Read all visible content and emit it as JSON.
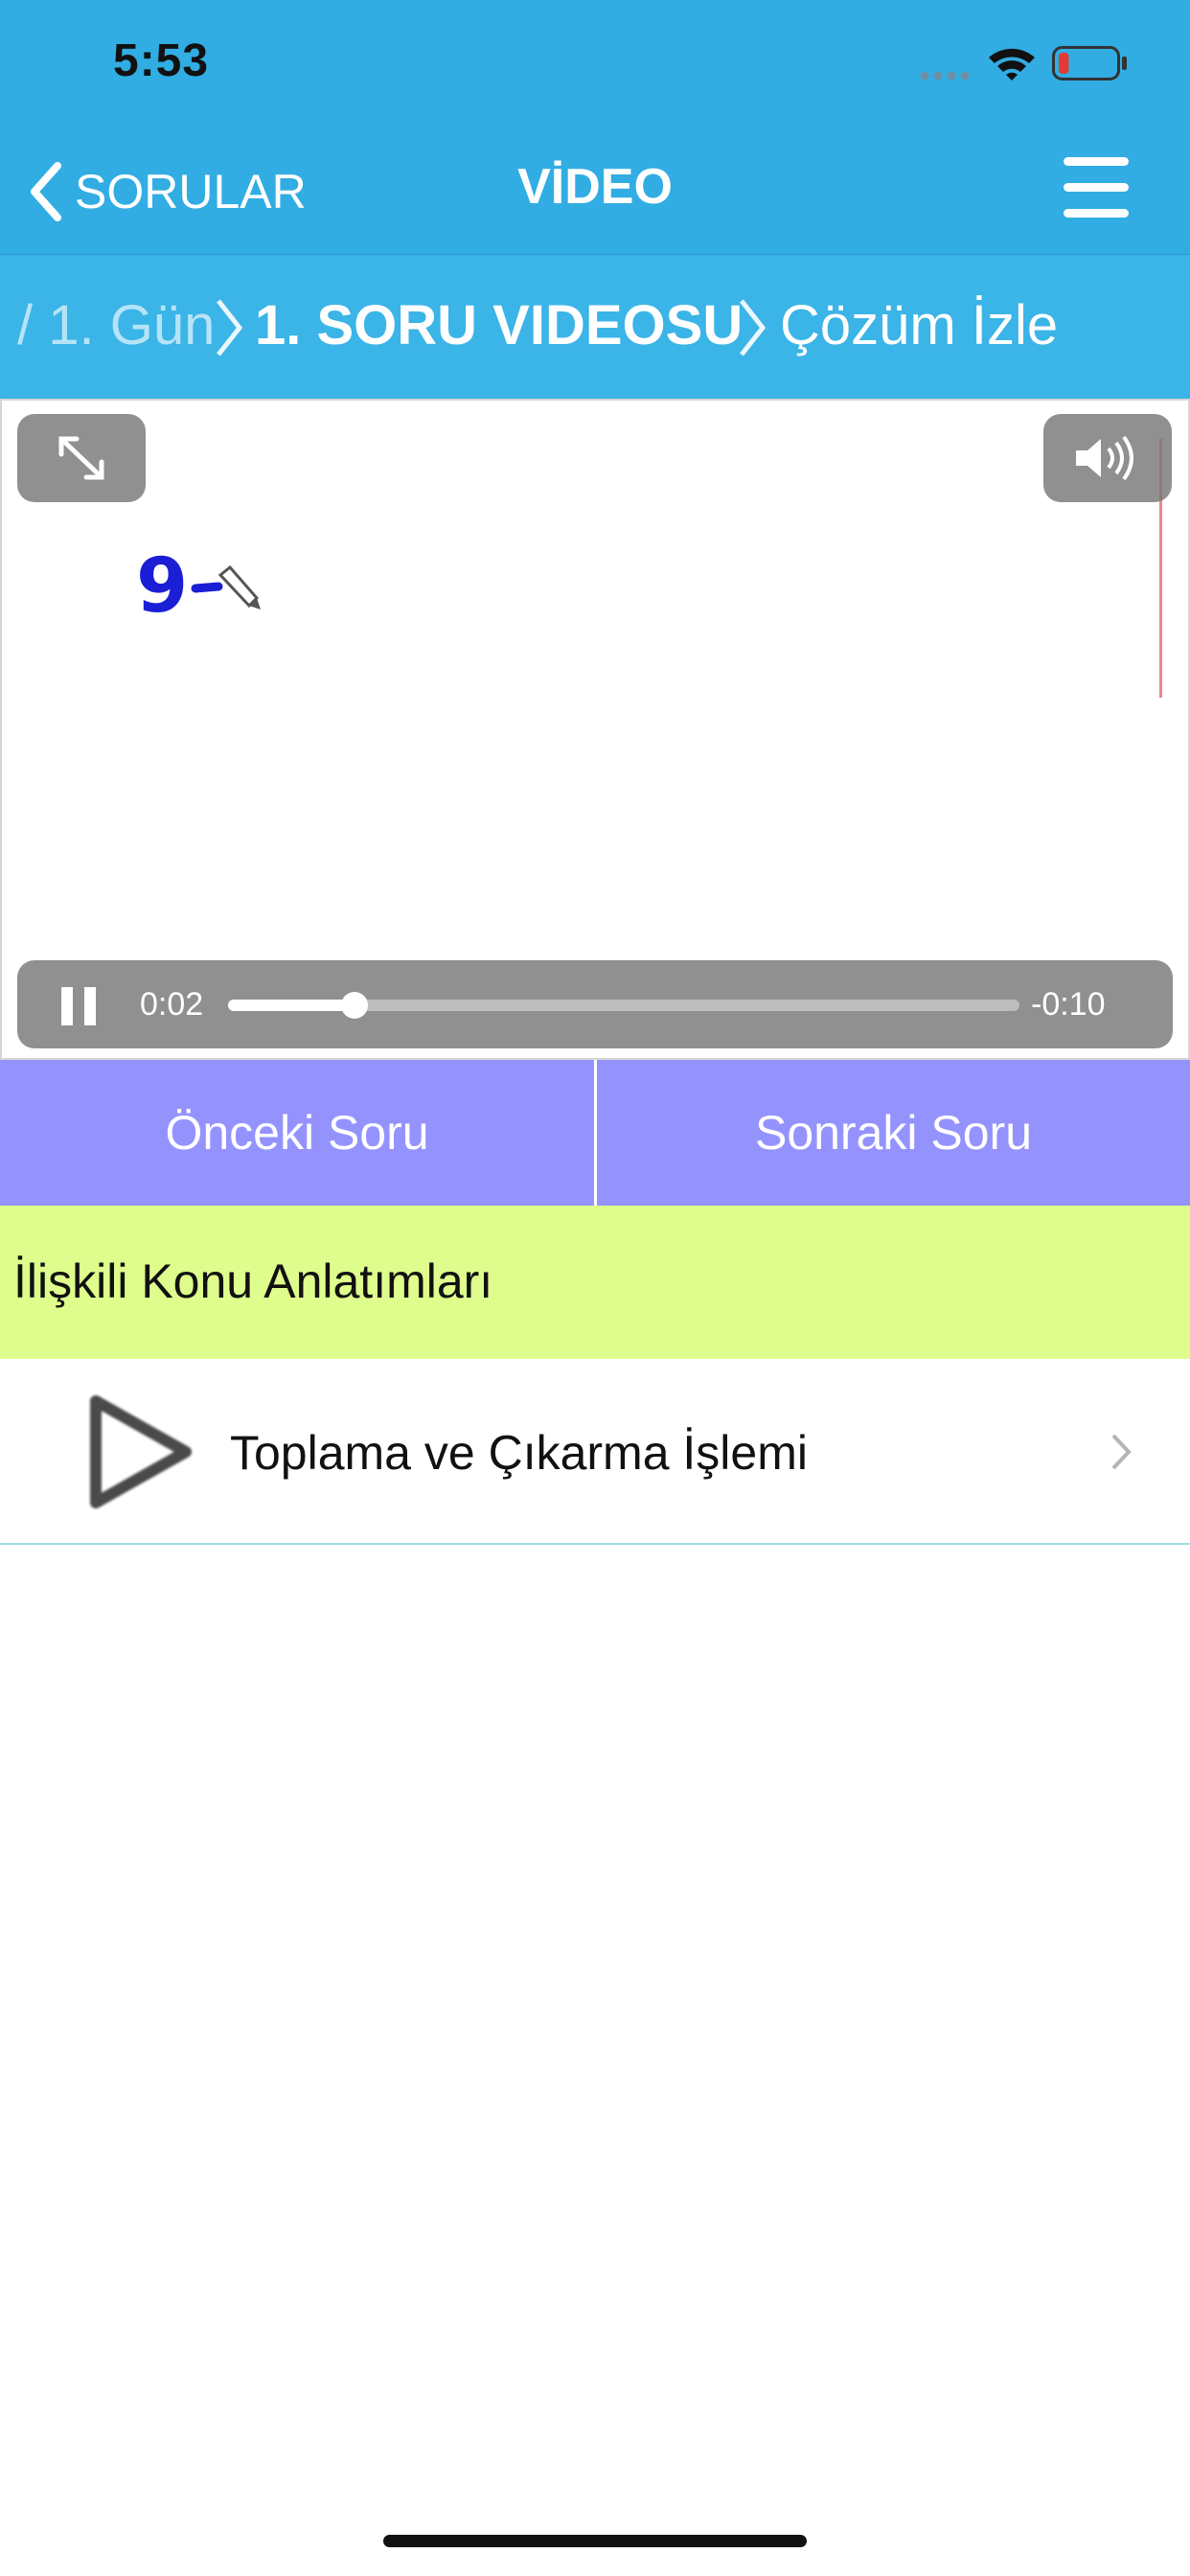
{
  "status_bar": {
    "time": "5:53",
    "battery_level": 0.18,
    "battery_color": "#e53935"
  },
  "nav": {
    "back_label": "SORULAR",
    "title": "VİDEO"
  },
  "breadcrumb": {
    "items": [
      {
        "label": "/ 1. Gün",
        "style": "faded"
      },
      {
        "label": "1. SORU VIDEOSU",
        "style": "bold"
      },
      {
        "label": "Çözüm İzle",
        "style": "normal"
      }
    ]
  },
  "video": {
    "board_text": "9",
    "current_time": "0:02",
    "remaining_time": "-0:10",
    "progress": 0.16
  },
  "buttons": {
    "prev": "Önceki Soru",
    "next": "Sonraki Soru"
  },
  "related": {
    "title": "İlişkili Konu Anlatımları",
    "items": [
      {
        "label": "Toplama ve Çıkarma İşlemi",
        "icon": "play-icon"
      }
    ]
  },
  "colors": {
    "primary": "#31ade3",
    "button": "#9493fe",
    "related_bg": "#dffd8d",
    "ink": "#1a1fd6"
  }
}
